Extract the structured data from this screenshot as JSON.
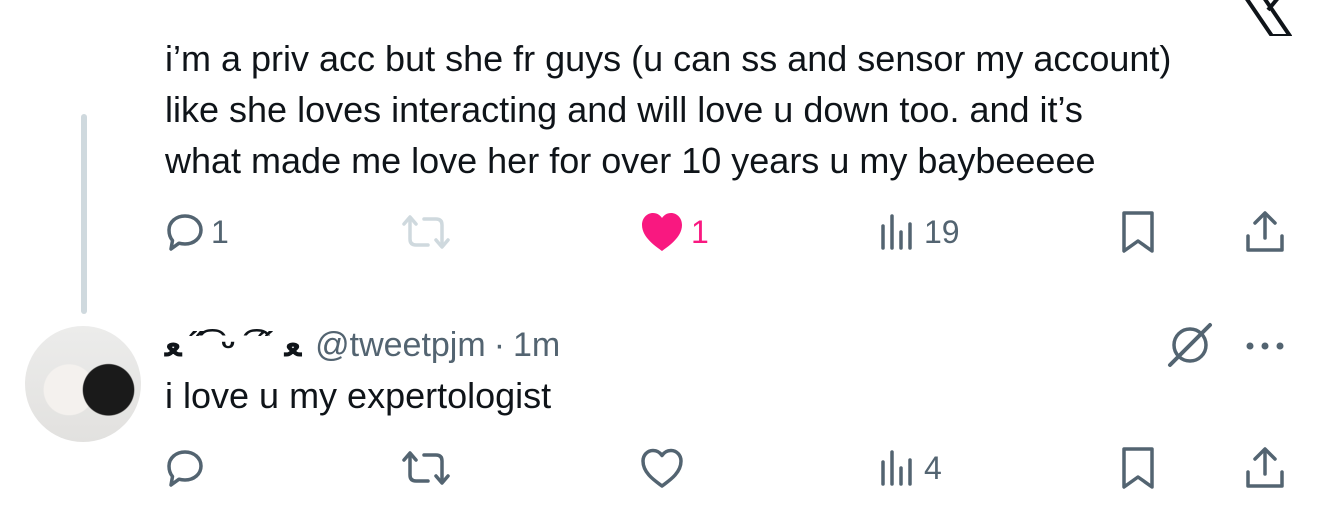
{
  "tweet": {
    "text": "i’m a priv acc but she fr guys (u can ss and sensor my account)\nlike she loves interacting and will love u down too. and it’s\nwhat made me love her for over 10 years u my baybeeeee",
    "replies": "1",
    "retweets": "",
    "likes": "1",
    "views": "19",
    "liked": true,
    "like_color": "#f91880"
  },
  "reply": {
    "display_name": "ﻌ ˝ ͡ ᵕ ͡ ˝ ﻌ",
    "handle": "@tweetpjm",
    "separator": "·",
    "time": "1m",
    "text": "i love u my expertologist",
    "replies": "",
    "retweets": "",
    "likes": "",
    "views": "4"
  },
  "icons": {
    "logo": "x-logo-icon",
    "reply": "speech-bubble-icon",
    "retweet": "retweet-icon",
    "like": "heart-icon",
    "views": "bar-chart-icon",
    "bookmark": "bookmark-icon",
    "share": "share-icon",
    "grok": "grok-icon",
    "more": "more-dots-icon"
  },
  "colors": {
    "text": "#0f1419",
    "secondary": "#536471",
    "thread_line": "#cfd9de"
  }
}
